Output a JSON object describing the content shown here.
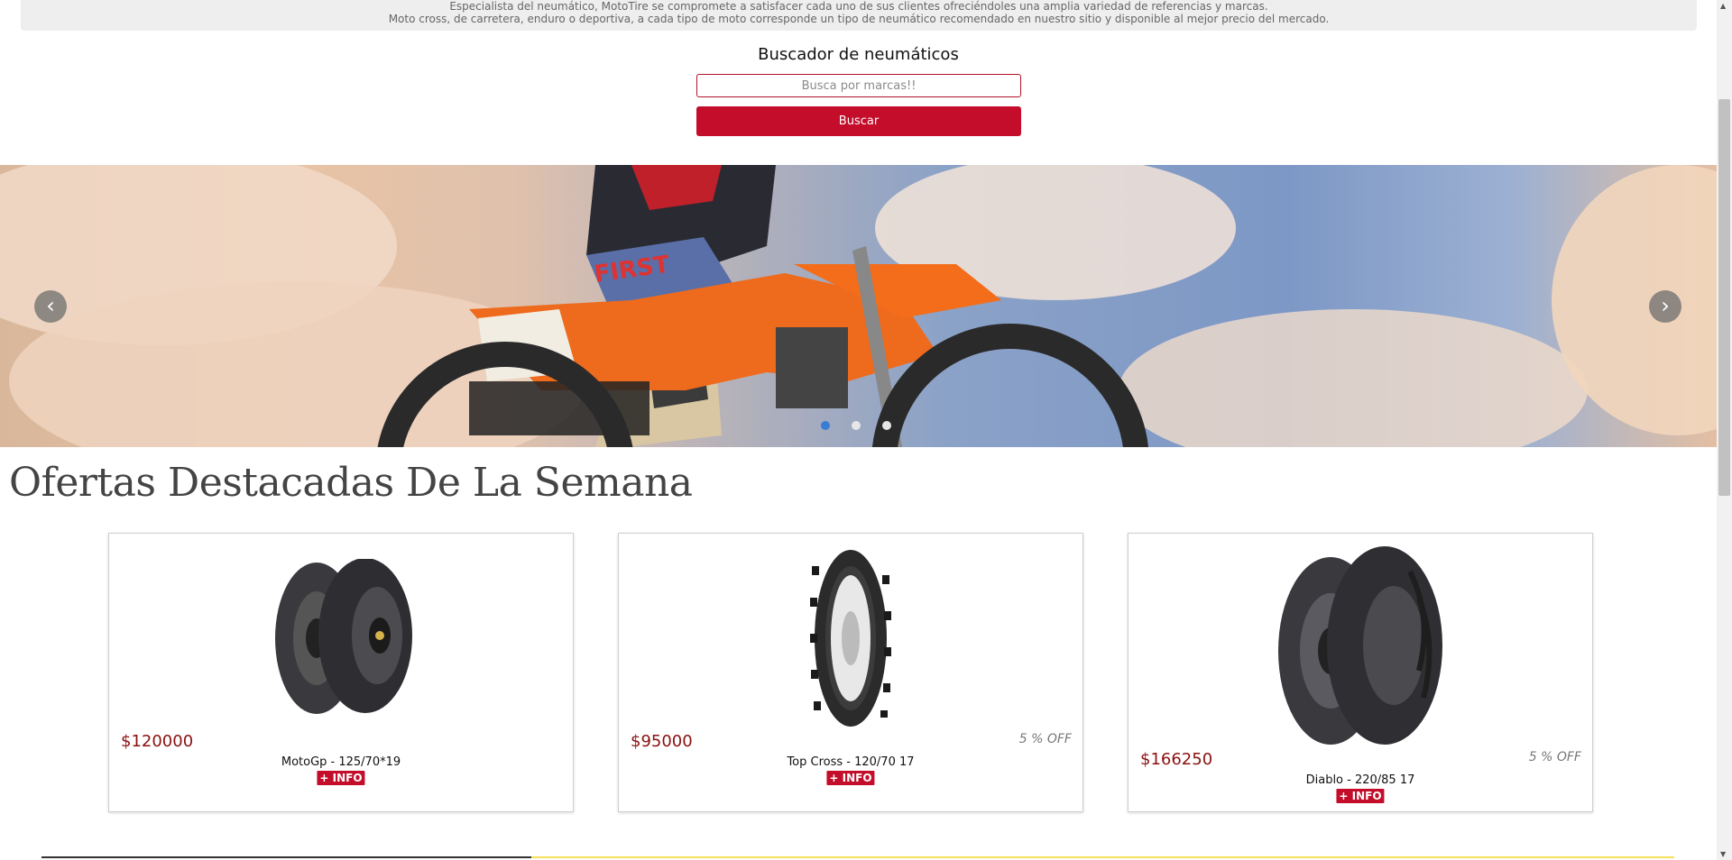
{
  "intro": {
    "line1": "Especialista del neumático, MotoTire se compromete a satisfacer cada uno de sus clientes ofreciéndoles una amplia variedad de referencias y marcas.",
    "line2": "Moto cross, de carretera, enduro o deportiva, a cada tipo de moto corresponde un tipo de neumático recomendado en nuestro sitio y disponible al mejor precio del mercado."
  },
  "search": {
    "title": "Buscador de neumáticos",
    "placeholder": "Busca por marcas!!",
    "button_label": "Buscar"
  },
  "carousel": {
    "prev_label": "‹",
    "next_label": "›",
    "slide_count": 3,
    "active_slide": 1
  },
  "section": {
    "title": "Ofertas Destacadas De La Semana"
  },
  "products": [
    {
      "price": "$120000",
      "discount": "",
      "name": "MotoGp - 125/70*19",
      "info_label": "+ INFO"
    },
    {
      "price": "$95000",
      "discount": "5 % OFF",
      "name": "Top Cross - 120/70 17",
      "info_label": "+ INFO"
    },
    {
      "price": "$166250",
      "discount": "5 % OFF",
      "name": "Diablo - 220/85 17",
      "info_label": "+ INFO"
    }
  ],
  "colors": {
    "brand_red": "#c30d2a",
    "price_red": "#8b1010",
    "carousel_dot_active": "#3a7bd5"
  }
}
